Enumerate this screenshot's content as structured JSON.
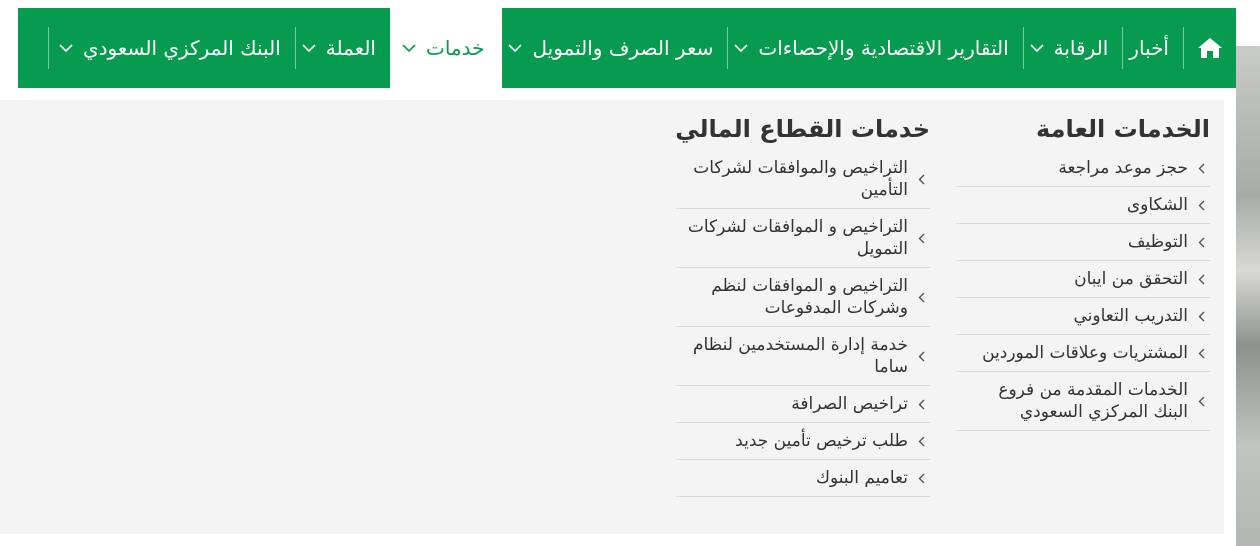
{
  "colors": {
    "brand_green": "#079b4f",
    "menu_bg": "#f4f4f4",
    "text": "#333333",
    "divider": "#d9d9d9"
  },
  "nav": {
    "home_icon": "home-icon",
    "items": [
      {
        "label": "أخبار",
        "has_dropdown": false,
        "active": false
      },
      {
        "label": "الرقابة",
        "has_dropdown": true,
        "active": false
      },
      {
        "label": "التقارير الاقتصادية والإحصاءات",
        "has_dropdown": true,
        "active": false
      },
      {
        "label": "سعر الصرف والتمويل",
        "has_dropdown": true,
        "active": false
      },
      {
        "label": "خدمات",
        "has_dropdown": true,
        "active": true
      },
      {
        "label": "العملة",
        "has_dropdown": true,
        "active": false
      },
      {
        "label": "البنك المركزي السعودي",
        "has_dropdown": true,
        "active": false
      }
    ]
  },
  "mega_menu": {
    "general_services": {
      "title": "الخدمات العامة",
      "items": [
        "حجز موعد مراجعة",
        "الشكاوى",
        "التوظيف",
        "التحقق من ايبان",
        "التدريب التعاوني",
        "المشتريات وعلاقات الموردين",
        "الخدمات المقدمة من فروع البنك المركزي السعودي"
      ]
    },
    "financial_sector_services": {
      "title": "خدمات القطاع المالي",
      "items": [
        "التراخيص والموافقات لشركات التأمين",
        "التراخيص و الموافقات لشركات التمويل",
        "التراخيص و الموافقات لنظم وشركات المدفوعات",
        "خدمة إدارة المستخدمين لنظام ساما",
        "تراخيص الصرافة",
        "طلب ترخيص تأمين جديد",
        "تعاميم البنوك"
      ]
    }
  }
}
